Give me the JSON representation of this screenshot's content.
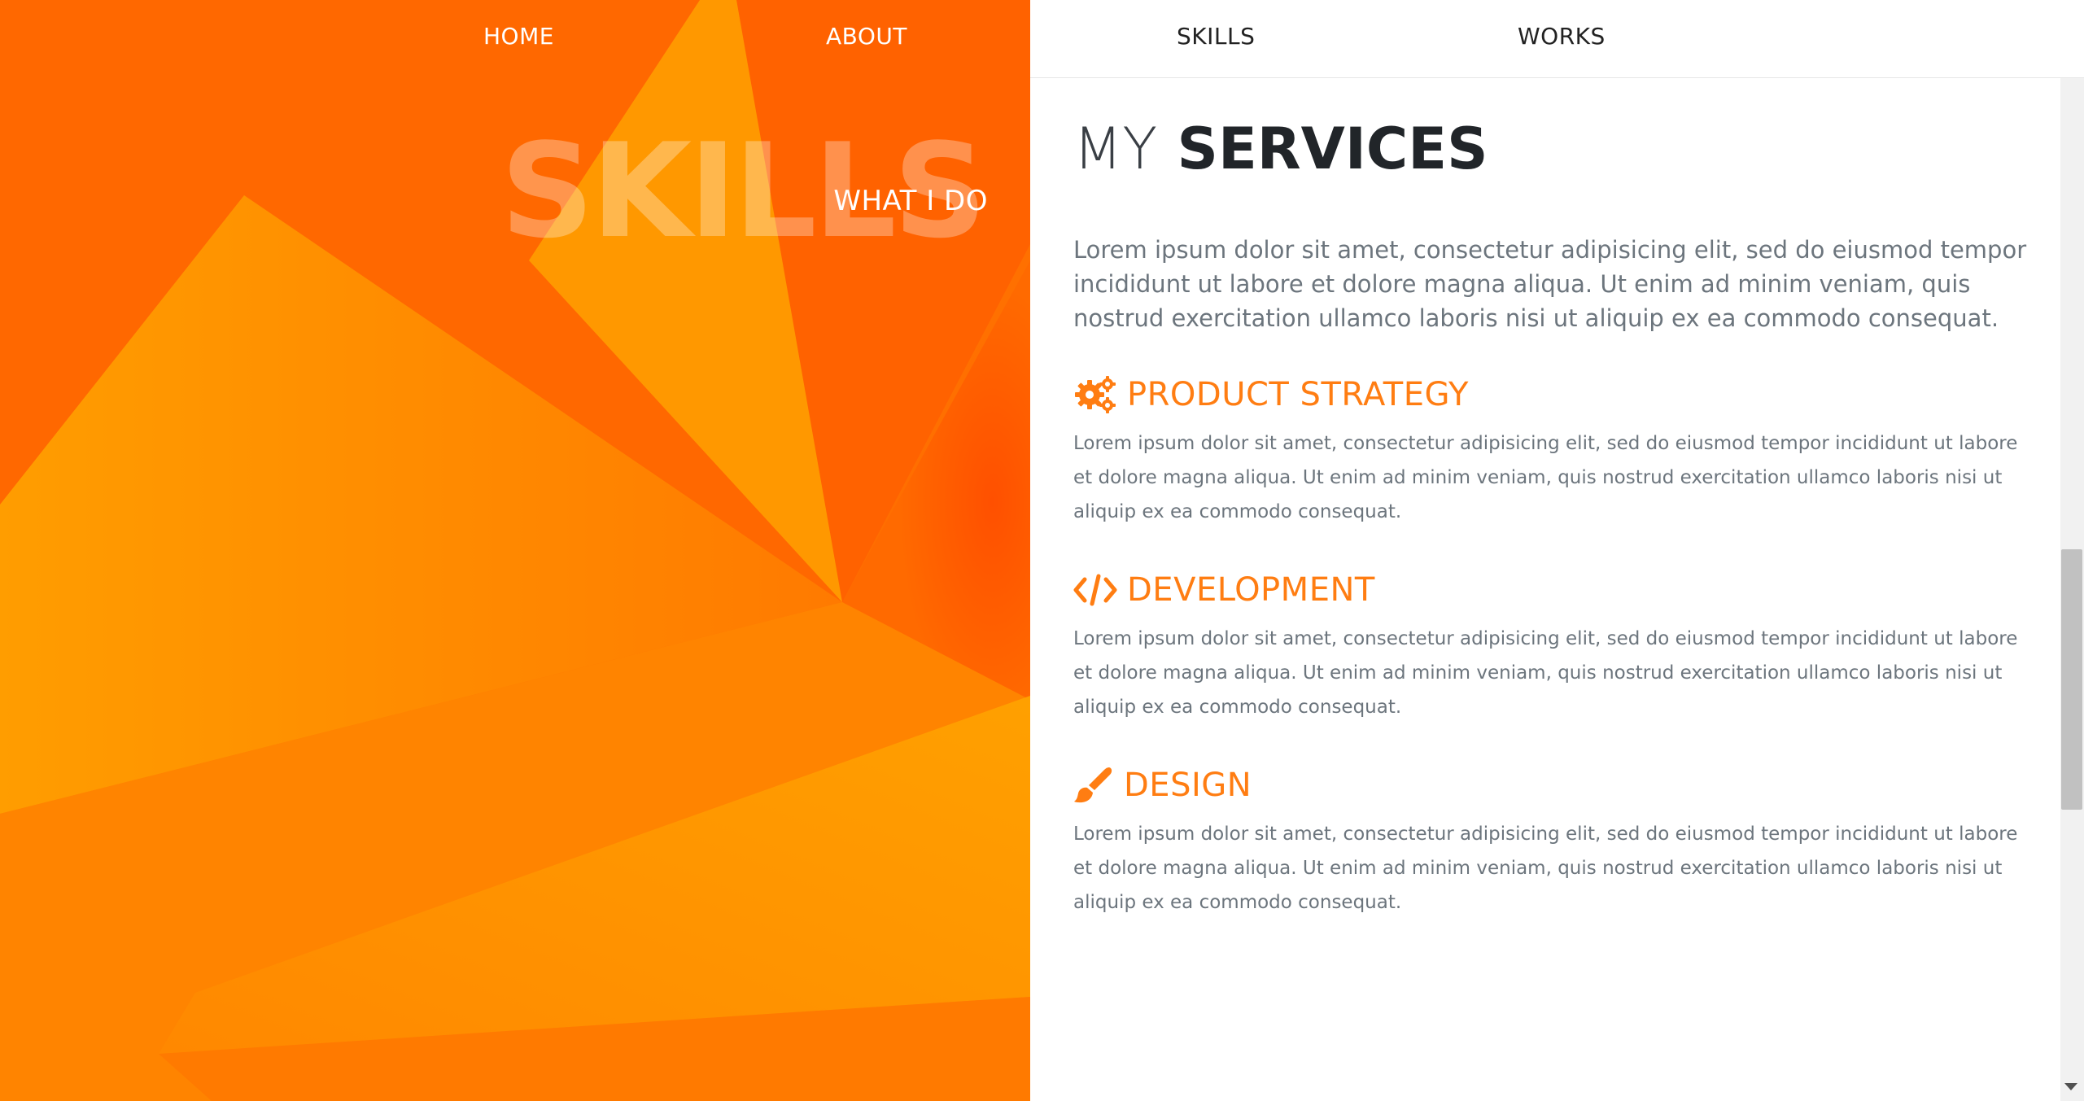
{
  "nav": {
    "items": [
      {
        "label": "HOME"
      },
      {
        "label": "ABOUT"
      },
      {
        "label": "SKILLS"
      },
      {
        "label": "WORKS"
      }
    ]
  },
  "hero": {
    "big_word": "SKILLS",
    "subtitle": "WHAT I DO"
  },
  "main": {
    "title_thin": "MY",
    "title_bold": "SERVICES",
    "intro": "Lorem ipsum dolor sit amet, consectetur adipisicing elit, sed do eiusmod tempor incididunt ut labore et dolore magna aliqua. Ut enim ad minim veniam, quis nostrud exercitation ullamco laboris nisi ut aliquip ex ea commodo consequat.",
    "services": [
      {
        "icon": "gears-icon",
        "title": "PRODUCT STRATEGY",
        "text": "Lorem ipsum dolor sit amet, consectetur adipisicing elit, sed do eiusmod tempor incididunt ut labore et dolore magna aliqua. Ut enim ad minim veniam, quis nostrud exercitation ullamco laboris nisi ut aliquip ex ea commodo consequat."
      },
      {
        "icon": "code-icon",
        "title": "DEVELOPMENT",
        "text": "Lorem ipsum dolor sit amet, consectetur adipisicing elit, sed do eiusmod tempor incididunt ut labore et dolore magna aliqua. Ut enim ad minim veniam, quis nostrud exercitation ullamco laboris nisi ut aliquip ex ea commodo consequat."
      },
      {
        "icon": "paintbrush-icon",
        "title": "DESIGN",
        "text": "Lorem ipsum dolor sit amet, consectetur adipisicing elit, sed do eiusmod tempor incididunt ut labore et dolore magna aliqua. Ut enim ad minim veniam, quis nostrud exercitation ullamco laboris nisi ut aliquip ex ea commodo consequat."
      }
    ]
  },
  "colors": {
    "accent": "#ff7d12",
    "panel_orange": "#ff6a00",
    "panel_light": "#ff9a00"
  }
}
